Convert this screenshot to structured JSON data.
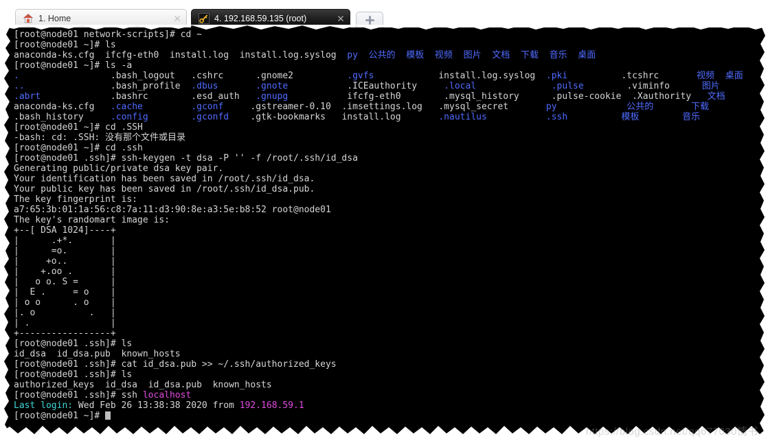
{
  "window": {
    "tabs": [
      {
        "label": "1. Home",
        "icon": "home-icon",
        "active": false,
        "close": "×"
      },
      {
        "label": "4. 192.168.59.135 (root)",
        "icon": "key-icon",
        "active": true,
        "close": "×"
      }
    ],
    "new_tab_label": "+"
  },
  "colors": {
    "background": "#000000",
    "foreground": "#d6d6d6",
    "directory_blue": "#4f6bff",
    "magenta": "#e24be2",
    "cyan": "#3fd7d7",
    "tab_active_bg": "#1d1d1d",
    "tab_inactive_bg": "#f0f0f0"
  },
  "terminal": {
    "lines": [
      {
        "id": "l01",
        "segs": [
          {
            "t": "[root@node01 network-scripts]# cd ~",
            "c": "w"
          }
        ]
      },
      {
        "id": "l02",
        "segs": [
          {
            "t": "[root@node01 ~]# ls",
            "c": "w"
          }
        ]
      },
      {
        "id": "l03",
        "segs": [
          {
            "t": "anaconda-ks.cfg  ifcfg-eth0  install.log  install.log.syslog  ",
            "c": "w"
          },
          {
            "t": "py",
            "c": "b"
          },
          {
            "t": "  ",
            "c": "w"
          },
          {
            "t": "公共的",
            "c": "b"
          },
          {
            "t": "  ",
            "c": "w"
          },
          {
            "t": "模板",
            "c": "b"
          },
          {
            "t": "  ",
            "c": "w"
          },
          {
            "t": "视频",
            "c": "b"
          },
          {
            "t": "  ",
            "c": "w"
          },
          {
            "t": "图片",
            "c": "b"
          },
          {
            "t": "  ",
            "c": "w"
          },
          {
            "t": "文档",
            "c": "b"
          },
          {
            "t": "  ",
            "c": "w"
          },
          {
            "t": "下载",
            "c": "b"
          },
          {
            "t": "  ",
            "c": "w"
          },
          {
            "t": "音乐",
            "c": "b"
          },
          {
            "t": "  ",
            "c": "w"
          },
          {
            "t": "桌面",
            "c": "b"
          }
        ]
      },
      {
        "id": "l04",
        "segs": [
          {
            "t": "[root@node01 ~]# ls -a",
            "c": "w"
          }
        ]
      },
      {
        "id": "l05",
        "segs": [
          {
            "t": ".",
            "c": "b"
          },
          {
            "t": "                 ",
            "c": "w"
          },
          {
            "t": ".bash_logout   .cshrc      .gnome2",
            "c": "w"
          },
          {
            "t": "          ",
            "c": "w"
          },
          {
            "t": ".gvfs",
            "c": "b"
          },
          {
            "t": "            install.log.syslog  ",
            "c": "w"
          },
          {
            "t": ".pki",
            "c": "b"
          },
          {
            "t": "          ",
            "c": "w"
          },
          {
            "t": ".tcshrc",
            "c": "w"
          },
          {
            "t": "       ",
            "c": "w"
          },
          {
            "t": "视频",
            "c": "b"
          },
          {
            "t": "  ",
            "c": "w"
          },
          {
            "t": "桌面",
            "c": "b"
          }
        ]
      },
      {
        "id": "l06",
        "segs": [
          {
            "t": "..",
            "c": "b"
          },
          {
            "t": "                ",
            "c": "w"
          },
          {
            "t": ".bash_profile  ",
            "c": "w"
          },
          {
            "t": ".dbus",
            "c": "b"
          },
          {
            "t": "       ",
            "c": "w"
          },
          {
            "t": ".gnote",
            "c": "b"
          },
          {
            "t": "           .ICEauthority     ",
            "c": "w"
          },
          {
            "t": ".local",
            "c": "b"
          },
          {
            "t": "              ",
            "c": "w"
          },
          {
            "t": ".pulse",
            "c": "b"
          },
          {
            "t": "        ",
            "c": "w"
          },
          {
            "t": ".viminfo",
            "c": "w"
          },
          {
            "t": "      ",
            "c": "w"
          },
          {
            "t": "图片",
            "c": "b"
          }
        ]
      },
      {
        "id": "l07",
        "segs": [
          {
            "t": ".abrt",
            "c": "b"
          },
          {
            "t": "             .bashrc        .esd_auth   ",
            "c": "w"
          },
          {
            "t": ".gnupg",
            "c": "b"
          },
          {
            "t": "           ifcfg-eth0        .mysql_history      .pulse-cookie  .Xauthority   ",
            "c": "w"
          },
          {
            "t": "文档",
            "c": "b"
          }
        ]
      },
      {
        "id": "l08",
        "segs": [
          {
            "t": "anaconda-ks.cfg   ",
            "c": "w"
          },
          {
            "t": ".cache",
            "c": "b"
          },
          {
            "t": "         ",
            "c": "w"
          },
          {
            "t": ".gconf",
            "c": "b"
          },
          {
            "t": "     ",
            "c": "w"
          },
          {
            "t": ".gstreamer-0.10  .imsettings.log   .mysql_secret       ",
            "c": "w"
          },
          {
            "t": "py",
            "c": "b"
          },
          {
            "t": "             ",
            "c": "w"
          },
          {
            "t": "公共的",
            "c": "b"
          },
          {
            "t": "       ",
            "c": "w"
          },
          {
            "t": "下载",
            "c": "b"
          }
        ]
      },
      {
        "id": "l09",
        "segs": [
          {
            "t": ".bash_history     ",
            "c": "w"
          },
          {
            "t": ".config",
            "c": "b"
          },
          {
            "t": "        ",
            "c": "w"
          },
          {
            "t": ".gconfd",
            "c": "b"
          },
          {
            "t": "    .gtk-bookmarks   install.log       ",
            "c": "w"
          },
          {
            "t": ".nautilus",
            "c": "b"
          },
          {
            "t": "           ",
            "c": "w"
          },
          {
            "t": ".ssh",
            "c": "b"
          },
          {
            "t": "          ",
            "c": "w"
          },
          {
            "t": "模板",
            "c": "b"
          },
          {
            "t": "        ",
            "c": "w"
          },
          {
            "t": "音乐",
            "c": "b"
          }
        ]
      },
      {
        "id": "l10",
        "segs": [
          {
            "t": "[root@node01 ~]# cd .SSH",
            "c": "w"
          }
        ]
      },
      {
        "id": "l11",
        "segs": [
          {
            "t": "-bash: cd: .SSH: 没有那个文件或目录",
            "c": "w"
          }
        ]
      },
      {
        "id": "l12",
        "segs": [
          {
            "t": "[root@node01 ~]# cd .ssh",
            "c": "w"
          }
        ]
      },
      {
        "id": "l13",
        "segs": [
          {
            "t": "[root@node01 .ssh]# ssh-keygen -t dsa -P '' -f /root/.ssh/id_dsa",
            "c": "w"
          }
        ]
      },
      {
        "id": "l14",
        "segs": [
          {
            "t": "Generating public/private dsa key pair.",
            "c": "w"
          }
        ]
      },
      {
        "id": "l15",
        "segs": [
          {
            "t": "Your identification has been saved in /root/.ssh/id_dsa.",
            "c": "w"
          }
        ]
      },
      {
        "id": "l16",
        "segs": [
          {
            "t": "Your public key has been saved in /root/.ssh/id_dsa.pub.",
            "c": "w"
          }
        ]
      },
      {
        "id": "l17",
        "segs": [
          {
            "t": "The key fingerprint is:",
            "c": "w"
          }
        ]
      },
      {
        "id": "l18",
        "segs": [
          {
            "t": "a7:65:3b:01:1a:56:c8:7a:11:d3:90:8e:a3:5e:b8:52 root@node01",
            "c": "w"
          }
        ]
      },
      {
        "id": "l19",
        "segs": [
          {
            "t": "The key's randomart image is:",
            "c": "w"
          }
        ]
      },
      {
        "id": "l20",
        "segs": [
          {
            "t": "+--[ DSA 1024]----+",
            "c": "w"
          }
        ]
      },
      {
        "id": "l21",
        "segs": [
          {
            "t": "|      .+*.       |",
            "c": "w"
          }
        ]
      },
      {
        "id": "l22",
        "segs": [
          {
            "t": "|      =o.        |",
            "c": "w"
          }
        ]
      },
      {
        "id": "l23",
        "segs": [
          {
            "t": "|     +o..        |",
            "c": "w"
          }
        ]
      },
      {
        "id": "l24",
        "segs": [
          {
            "t": "|    +.oo .       |",
            "c": "w"
          }
        ]
      },
      {
        "id": "l25",
        "segs": [
          {
            "t": "|   o o. S =      |",
            "c": "w"
          }
        ]
      },
      {
        "id": "l26",
        "segs": [
          {
            "t": "|  E .     = o    |",
            "c": "w"
          }
        ]
      },
      {
        "id": "l27",
        "segs": [
          {
            "t": "| o o      . o    |",
            "c": "w"
          }
        ]
      },
      {
        "id": "l28",
        "segs": [
          {
            "t": "|. o          .   |",
            "c": "w"
          }
        ]
      },
      {
        "id": "l29",
        "segs": [
          {
            "t": "| .               |",
            "c": "w"
          }
        ]
      },
      {
        "id": "l30",
        "segs": [
          {
            "t": "+-----------------+",
            "c": "w"
          }
        ]
      },
      {
        "id": "l31",
        "segs": [
          {
            "t": "[root@node01 .ssh]# ls",
            "c": "w"
          }
        ]
      },
      {
        "id": "l32",
        "segs": [
          {
            "t": "id_dsa  id_dsa.pub  known_hosts",
            "c": "w"
          }
        ]
      },
      {
        "id": "l33",
        "segs": [
          {
            "t": "[root@node01 .ssh]# cat id_dsa.pub >> ~/.ssh/authorized_keys",
            "c": "w"
          }
        ]
      },
      {
        "id": "l34",
        "segs": [
          {
            "t": "[root@node01 .ssh]# ls",
            "c": "w"
          }
        ]
      },
      {
        "id": "l35",
        "segs": [
          {
            "t": "authorized_keys  id_dsa  id_dsa.pub  known_hosts",
            "c": "w"
          }
        ]
      },
      {
        "id": "l36",
        "segs": [
          {
            "t": "[root@node01 .ssh]# ssh ",
            "c": "w"
          },
          {
            "t": "localhost",
            "c": "m"
          }
        ]
      },
      {
        "id": "l37",
        "segs": [
          {
            "t": "Last login:",
            "c": "c"
          },
          {
            "t": " Wed Feb 26 13:38:38 2020 from ",
            "c": "w"
          },
          {
            "t": "192.168.59.1",
            "c": "m"
          }
        ]
      },
      {
        "id": "l38",
        "segs": [
          {
            "t": "[root@node01 ~]# ",
            "c": "w"
          }
        ],
        "cursor": true
      }
    ]
  },
  "watermark": {
    "text": "https://blog.csdn.net/qq677030情书"
  }
}
